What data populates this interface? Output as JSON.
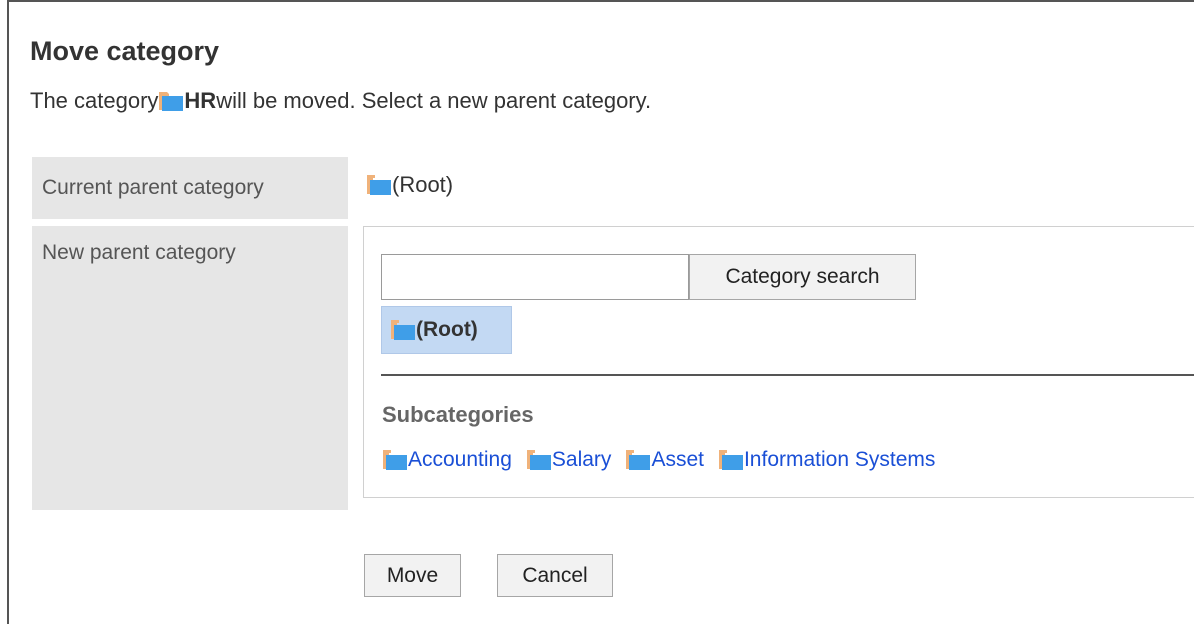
{
  "dialog": {
    "title": "Move category",
    "description_prefix": "The category ",
    "category_name": "HR",
    "description_suffix": " will be moved. Select a new parent category."
  },
  "current_parent": {
    "label": "Current parent category",
    "value": "(Root)"
  },
  "new_parent": {
    "label": "New parent category",
    "search": {
      "value": "",
      "placeholder": "",
      "button_label": "Category search"
    },
    "selected": "(Root)",
    "subcategories_title": "Subcategories",
    "subcategories": [
      "Accounting",
      "Salary",
      "Asset",
      "Information Systems"
    ]
  },
  "actions": {
    "move_label": "Move",
    "cancel_label": "Cancel"
  },
  "colors": {
    "link": "#1a4fd6",
    "selected_bg": "#c3d9f3",
    "label_bg": "#e6e6e6",
    "folder_blue": "#3f9ee8",
    "folder_tan": "#f0b27a"
  },
  "icons": {
    "category": "folder-icon"
  }
}
